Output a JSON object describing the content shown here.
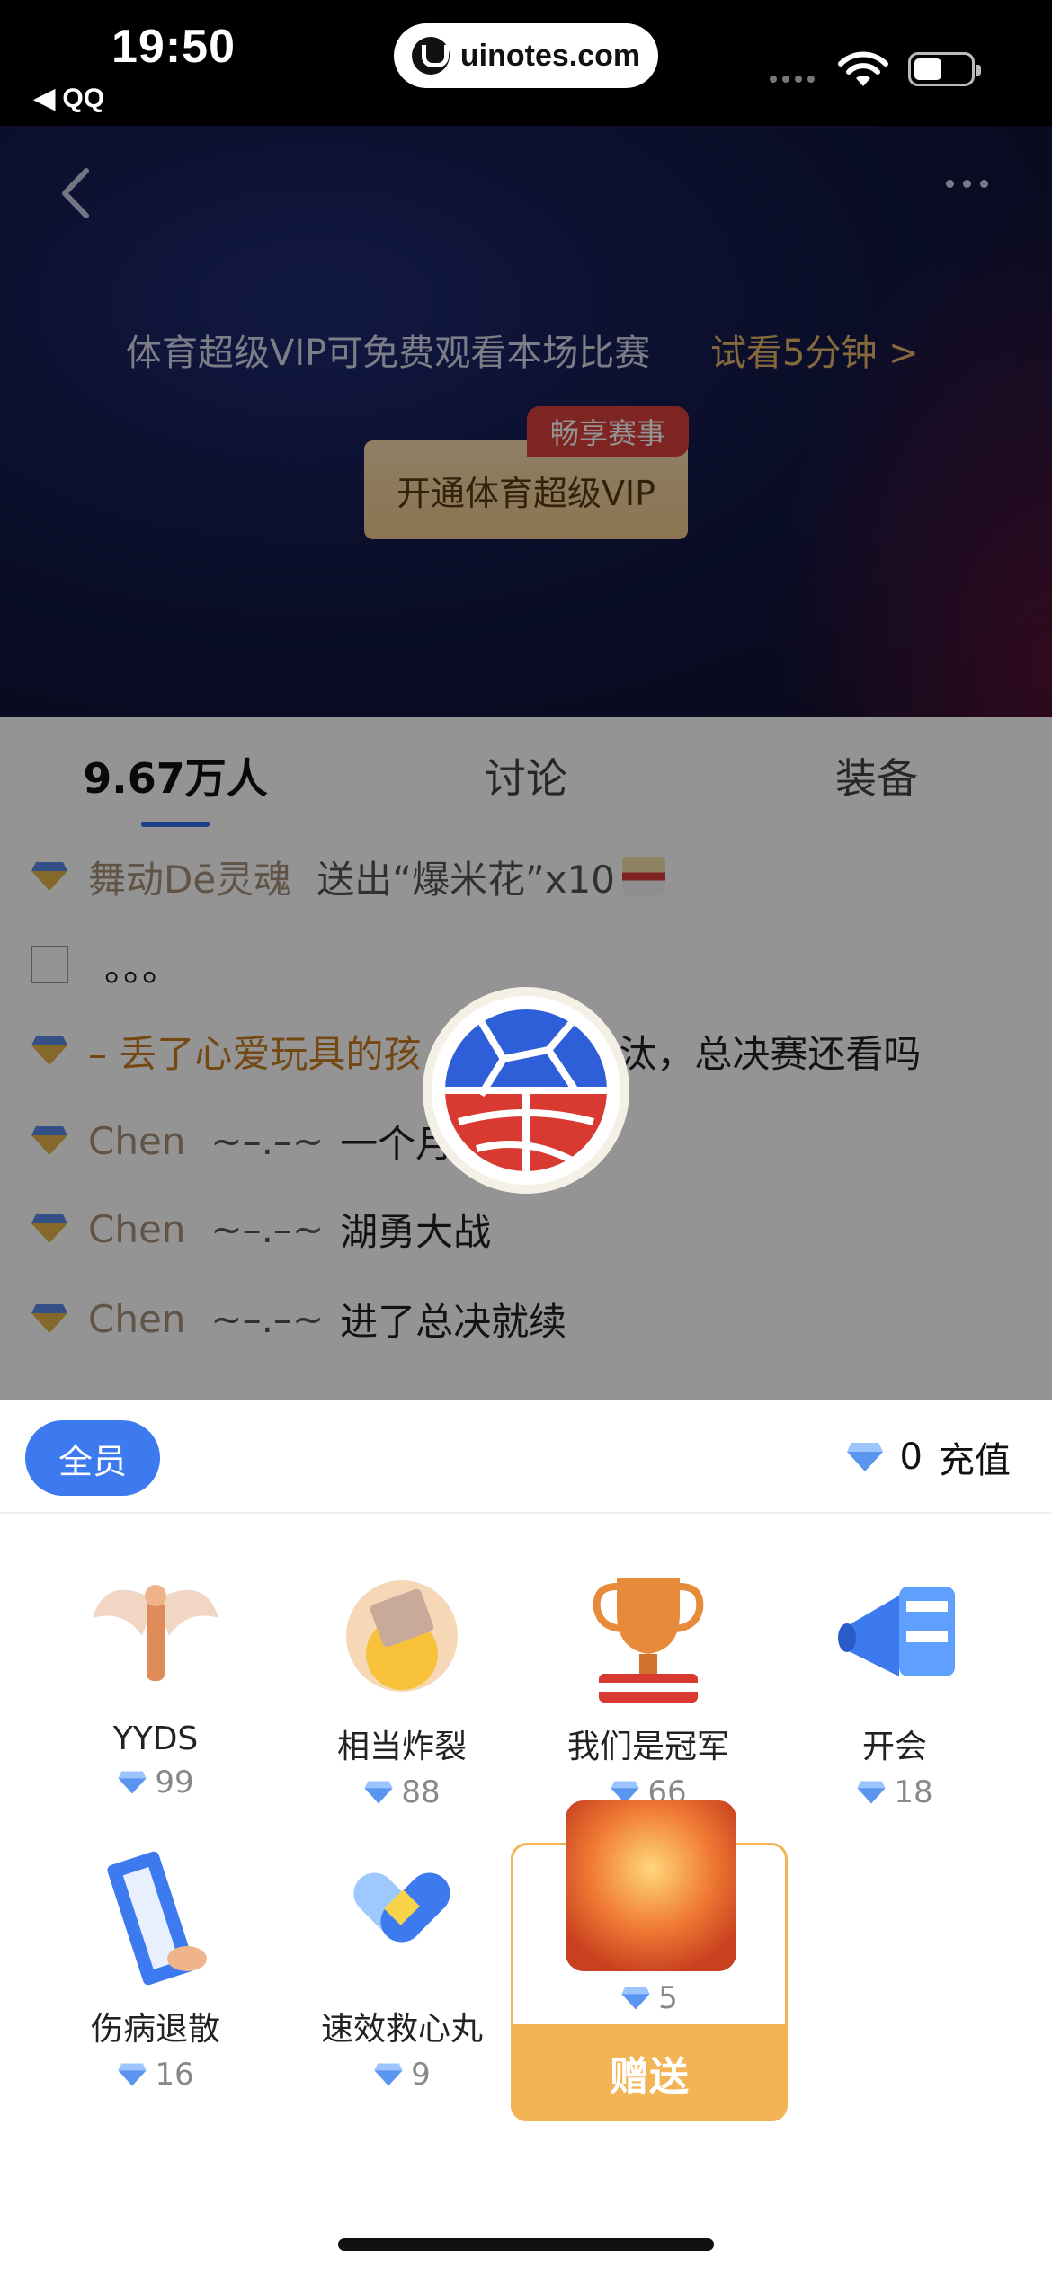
{
  "status_bar": {
    "time": "19:50",
    "back_app": "◀ QQ",
    "url": "uinotes.com"
  },
  "video": {
    "vip_message": "体育超级VIP可免费观看本场比赛",
    "trial_link": "试看5分钟 >",
    "vip_button": "开通体育超级VIP",
    "vip_badge": "畅享赛事"
  },
  "tabs": [
    {
      "label": "9.67万人",
      "active": true
    },
    {
      "label": "讨论",
      "active": false
    },
    {
      "label": "装备",
      "active": false
    }
  ],
  "chat": {
    "messages": [
      {
        "nick": "舞动Dē灵魂",
        "text": "送出“爆米花”x10"
      },
      {
        "nick": "",
        "text": "。。。"
      },
      {
        "nick": "– 丢了心爱玩具的孩",
        "text": "淘汰，总决赛还看吗"
      },
      {
        "nick": "Chen",
        "sep": "~–.–~",
        "text": "一个月的"
      },
      {
        "nick": "Chen",
        "sep": "~–.–~",
        "text": "湖勇大战"
      },
      {
        "nick": "Chen",
        "sep": "~–.–~",
        "text": "进了总决就续"
      }
    ]
  },
  "gift_panel": {
    "audience_button": "全员",
    "balance": "0",
    "recharge": "充值",
    "gifts": [
      {
        "name": "YYDS",
        "price": "99",
        "icon": "angel-wings-icon"
      },
      {
        "name": "相当炸裂",
        "price": "88",
        "icon": "explosion-icon"
      },
      {
        "name": "我们是冠军",
        "price": "66",
        "icon": "trophy-icon"
      },
      {
        "name": "开会",
        "price": "18",
        "icon": "megaphone-icon"
      },
      {
        "name": "伤病退散",
        "price": "16",
        "icon": "talisman-icon"
      },
      {
        "name": "速效救心丸",
        "price": "9",
        "icon": "pill-capsule-icon"
      }
    ],
    "selected_gift": {
      "price": "5",
      "icon": "fire-gift-icon"
    },
    "send_button": "赠送"
  },
  "colors": {
    "accent_blue": "#3d7af0",
    "send_orange": "#f3b455",
    "vip_gold": "#efc98d",
    "badge_red": "#d9413d"
  }
}
